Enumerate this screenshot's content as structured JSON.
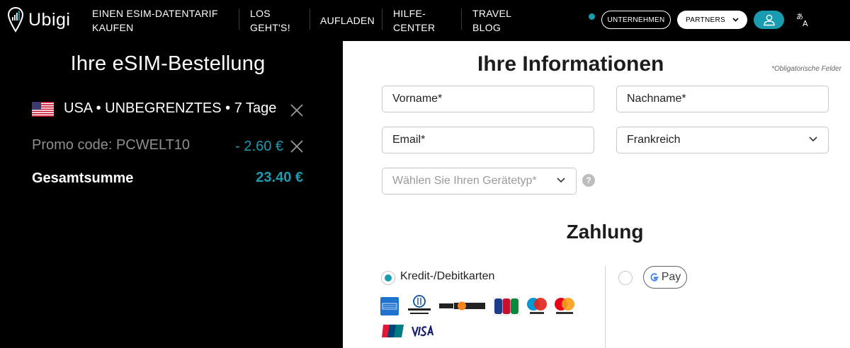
{
  "brand": {
    "name": "Ubigi",
    "accent": "#1a9cb0"
  },
  "nav": {
    "items": [
      {
        "line1": "EINEN ESIM-DATENTARIF",
        "line2": "KAUFEN"
      },
      {
        "line1": "LOS",
        "line2": "GEHT'S!"
      },
      {
        "line1": "AUFLADEN",
        "line2": ""
      },
      {
        "line1": "HILFE-",
        "line2": "CENTER"
      },
      {
        "line1": "TRAVEL",
        "line2": "BLOG"
      }
    ],
    "business_button": "UNTERNEHMEN",
    "partners_button": "PARTNERS",
    "account_icon": "user-icon",
    "language_icon": "translate-icon"
  },
  "order": {
    "title": "Ihre eSIM-Bestellung",
    "product": "USA • UNBEGRENZTES • 7 Tage",
    "flag_icon": "us-flag-icon",
    "promo_label": "Promo code: PCWELT10",
    "promo_amount": "- 2.60 €",
    "total_label": "Gesamtsumme",
    "total_amount": "23.40 €"
  },
  "form": {
    "title": "Ihre Informationen",
    "required_note": "*Obligatorische Felder",
    "first_name_placeholder": "Vorname*",
    "last_name_placeholder": "Nachname*",
    "email_placeholder": "Email*",
    "country_value": "Frankreich",
    "device_placeholder": "Wählen Sie Ihren Gerätetyp*",
    "help_glyph": "?"
  },
  "payment": {
    "title": "Zahlung",
    "card_option_label": "Kredit-/Debitkarten",
    "card_option_selected": true,
    "gpay_option_selected": false,
    "gpay_label": "Pay",
    "card_logos": [
      "American Express",
      "Diners Club International",
      "Discover",
      "JCB",
      "Maestro",
      "Mastercard",
      "UnionPay",
      "VISA"
    ]
  }
}
